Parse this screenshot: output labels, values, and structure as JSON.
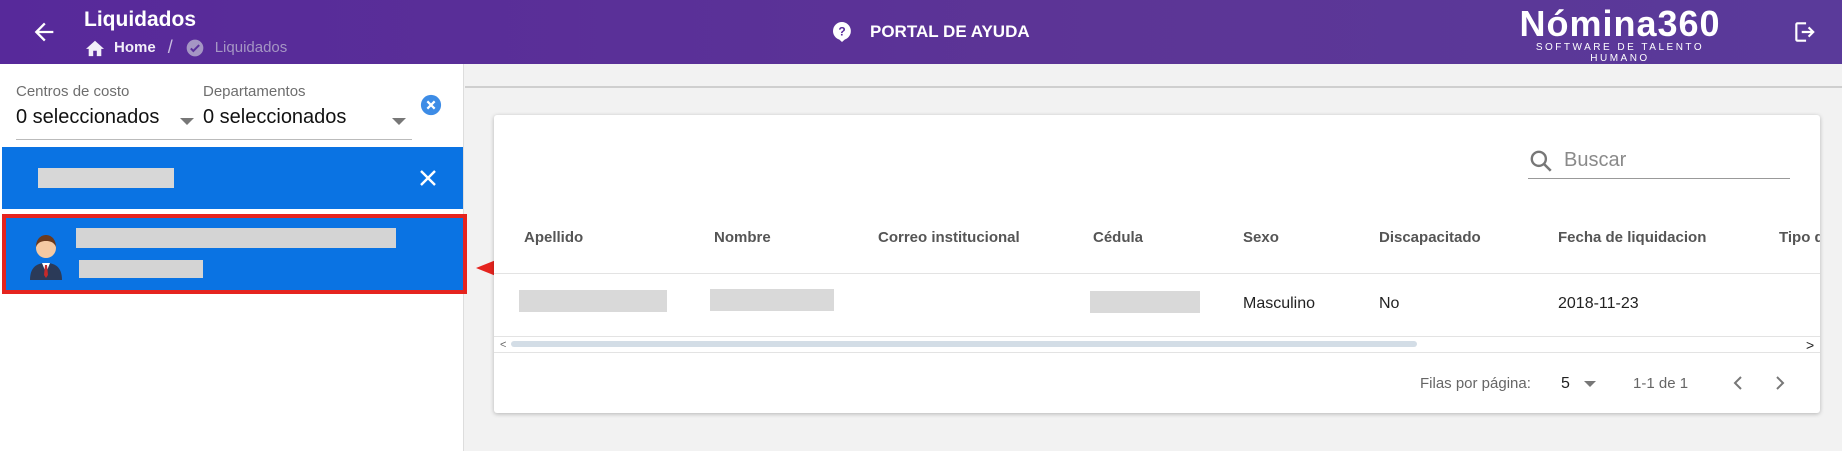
{
  "header": {
    "title": "Liquidados",
    "breadcrumb_home": "Home",
    "breadcrumb_current": "Liquidados",
    "help_label": "PORTAL DE AYUDA",
    "logo_name": "Nómina360",
    "logo_tagline": "SOFTWARE DE TALENTO HUMANO"
  },
  "filters": {
    "cost_centers_label": "Centros de costo",
    "cost_centers_value": "0 seleccionados",
    "departments_label": "Departamentos",
    "departments_value": "0 seleccionados"
  },
  "table": {
    "search_placeholder": "Buscar",
    "columns": [
      "Apellido",
      "Nombre",
      "Correo institucional",
      "Cédula",
      "Sexo",
      "Discapacitado",
      "Fecha de liquidacion",
      "Tipo d"
    ],
    "rows": [
      {
        "apellido": "",
        "nombre": "",
        "correo": "",
        "cedula": "",
        "sexo": "Masculino",
        "discapacitado": "No",
        "fecha": "2018-11-23"
      }
    ],
    "rows_per_page_label": "Filas por página:",
    "rows_per_page_value": "5",
    "page_range": "1-1 de 1"
  },
  "colors": {
    "header_bg": "#57299a",
    "selection_blue": "#0a73e3",
    "highlight_red": "#e5241f"
  }
}
